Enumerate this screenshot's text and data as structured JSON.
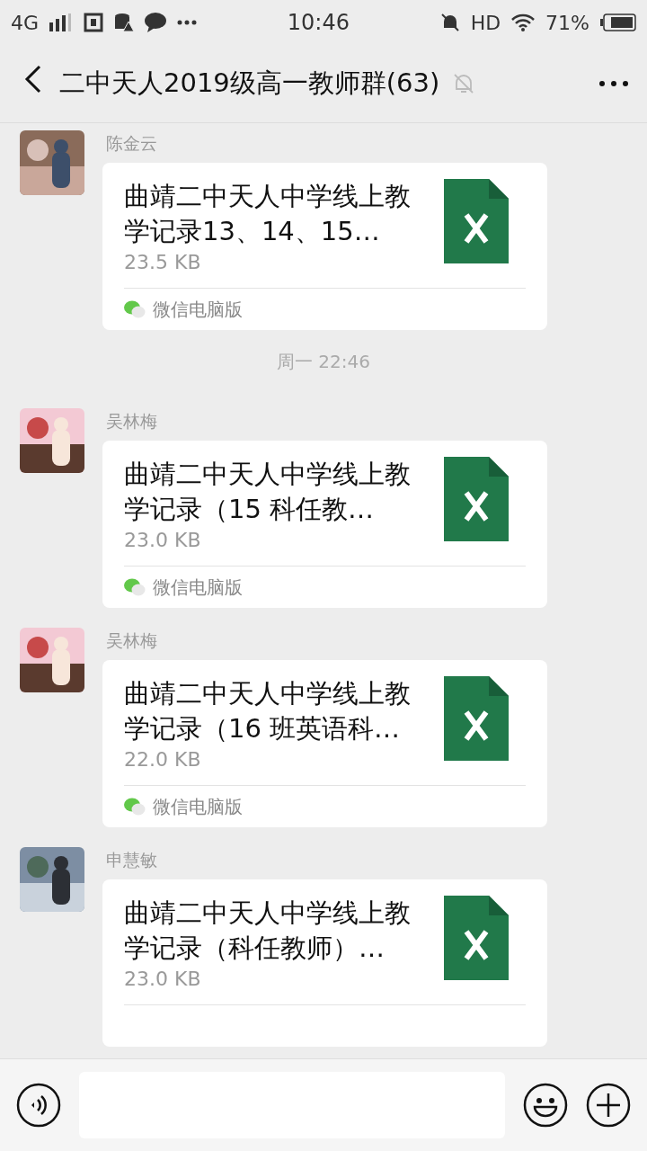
{
  "status_bar": {
    "network": "4G",
    "time": "10:46",
    "hd": "HD",
    "battery": "71%"
  },
  "header": {
    "title": "二中天人2019级高一教师群(63)",
    "muted": true
  },
  "messages": [
    {
      "kind": "file",
      "sender": "陈金云",
      "file_name": "曲靖二中天人中学线上教学记录13、14、15…",
      "size": "23.5 KB",
      "source": "微信电脑版"
    },
    {
      "kind": "time",
      "text": "周一 22:46"
    },
    {
      "kind": "file",
      "sender": "吴林梅",
      "file_name": "曲靖二中天人中学线上教学记录（15 科任教…",
      "size": "23.0 KB",
      "source": "微信电脑版"
    },
    {
      "kind": "file",
      "sender": "吴林梅",
      "file_name": "曲靖二中天人中学线上教学记录（16 班英语科…",
      "size": "22.0 KB",
      "source": "微信电脑版"
    },
    {
      "kind": "file",
      "sender": "申慧敏",
      "file_name": "曲靖二中天人中学线上教学记录（科任教师）…",
      "size": "23.0 KB"
    }
  ]
}
